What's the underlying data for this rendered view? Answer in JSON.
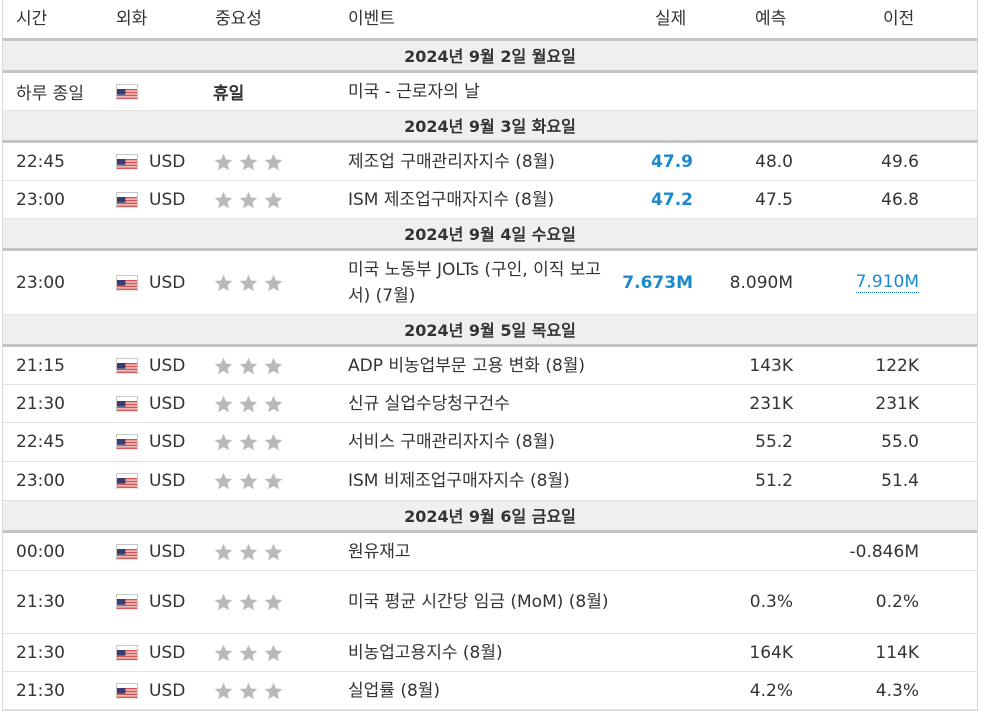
{
  "header": {
    "time": "시간",
    "currency": "외화",
    "importance": "중요성",
    "event": "이벤트",
    "actual": "실제",
    "forecast": "예측",
    "previous": "이전"
  },
  "days": [
    {
      "label": "2024년 9월 2일 월요일",
      "rows": [
        {
          "time": "하루 종일",
          "currency": "",
          "holiday": "휴일",
          "event": "미국 - 근로자의 날",
          "actual": "",
          "forecast": "",
          "previous": ""
        }
      ]
    },
    {
      "label": "2024년 9월 3일 화요일",
      "rows": [
        {
          "time": "22:45",
          "currency": "USD",
          "event": "제조업 구매관리자지수 (8월)",
          "actual": "47.9",
          "forecast": "48.0",
          "previous": "49.6"
        },
        {
          "time": "23:00",
          "currency": "USD",
          "event": "ISM 제조업구매자지수 (8월)",
          "actual": "47.2",
          "forecast": "47.5",
          "previous": "46.8"
        }
      ]
    },
    {
      "label": "2024년 9월 4일 수요일",
      "rows": [
        {
          "time": "23:00",
          "currency": "USD",
          "event": "미국 노동부 JOLTs (구인, 이직 보고서) (7월)",
          "actual": "7.673M",
          "forecast": "8.090M",
          "previous": "7.910M",
          "previous_revised": true
        }
      ]
    },
    {
      "label": "2024년 9월 5일 목요일",
      "rows": [
        {
          "time": "21:15",
          "currency": "USD",
          "event": "ADP 비농업부문 고용 변화 (8월)",
          "actual": "",
          "forecast": "143K",
          "previous": "122K"
        },
        {
          "time": "21:30",
          "currency": "USD",
          "event": "신규 실업수당청구건수",
          "actual": "",
          "forecast": "231K",
          "previous": "231K"
        },
        {
          "time": "22:45",
          "currency": "USD",
          "event": "서비스 구매관리자지수 (8월)",
          "actual": "",
          "forecast": "55.2",
          "previous": "55.0"
        },
        {
          "time": "23:00",
          "currency": "USD",
          "event": "ISM 비제조업구매자지수 (8월)",
          "actual": "",
          "forecast": "51.2",
          "previous": "51.4"
        }
      ]
    },
    {
      "label": "2024년 9월 6일 금요일",
      "rows": [
        {
          "time": "00:00",
          "currency": "USD",
          "event": "원유재고",
          "actual": "",
          "forecast": "",
          "previous": "-0.846M"
        },
        {
          "time": "21:30",
          "currency": "USD",
          "event": "미국 평균 시간당 임금 (MoM) (8월)",
          "actual": "",
          "forecast": "0.3%",
          "previous": "0.2%"
        },
        {
          "time": "21:30",
          "currency": "USD",
          "event": "비농업고용지수 (8월)",
          "actual": "",
          "forecast": "164K",
          "previous": "114K"
        },
        {
          "time": "21:30",
          "currency": "USD",
          "event": "실업률 (8월)",
          "actual": "",
          "forecast": "4.2%",
          "previous": "4.3%"
        }
      ]
    }
  ],
  "icons": {
    "flag": "us-flag-icon",
    "importance": "star-icon"
  },
  "colors": {
    "actual": "#1a8acd",
    "star": "#b9b9b9",
    "day_bg": "#efefef"
  }
}
